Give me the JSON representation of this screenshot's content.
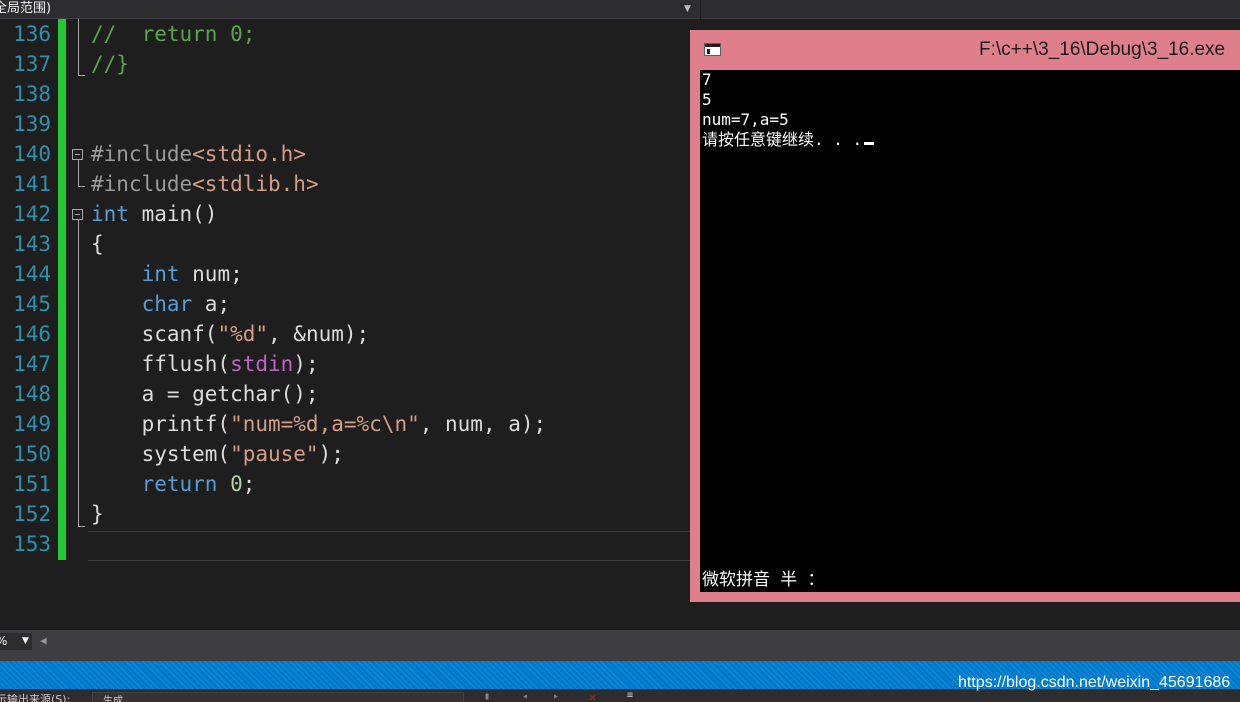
{
  "scope_bar": {
    "label": "全局范围)"
  },
  "editor": {
    "lines": [
      {
        "n": "136",
        "tokens": [
          [
            "cm",
            "//  return 0;"
          ]
        ]
      },
      {
        "n": "137",
        "tokens": [
          [
            "cm",
            "//}"
          ]
        ]
      },
      {
        "n": "138",
        "tokens": []
      },
      {
        "n": "139",
        "tokens": []
      },
      {
        "n": "140",
        "tokens": [
          [
            "pp",
            "#include"
          ],
          [
            "str",
            "<stdio.h>"
          ]
        ]
      },
      {
        "n": "141",
        "tokens": [
          [
            "pp",
            "#include"
          ],
          [
            "str",
            "<stdlib.h>"
          ]
        ]
      },
      {
        "n": "142",
        "tokens": [
          [
            "kw",
            "int"
          ],
          [
            "tx",
            " main()"
          ]
        ]
      },
      {
        "n": "143",
        "tokens": [
          [
            "tx",
            "{"
          ]
        ]
      },
      {
        "n": "144",
        "tokens": [
          [
            "tx",
            "    "
          ],
          [
            "kw",
            "int"
          ],
          [
            "tx",
            " num;"
          ]
        ]
      },
      {
        "n": "145",
        "tokens": [
          [
            "tx",
            "    "
          ],
          [
            "kw",
            "char"
          ],
          [
            "tx",
            " a;"
          ]
        ]
      },
      {
        "n": "146",
        "tokens": [
          [
            "tx",
            "    scanf("
          ],
          [
            "str",
            "\"%d\""
          ],
          [
            "tx",
            ", &num);"
          ]
        ]
      },
      {
        "n": "147",
        "tokens": [
          [
            "tx",
            "    fflush("
          ],
          [
            "mac",
            "stdin"
          ],
          [
            "tx",
            ");"
          ]
        ]
      },
      {
        "n": "148",
        "tokens": [
          [
            "tx",
            "    a = getchar();"
          ]
        ]
      },
      {
        "n": "149",
        "tokens": [
          [
            "tx",
            "    printf("
          ],
          [
            "str",
            "\"num=%d,a=%c\\n\""
          ],
          [
            "tx",
            ", num, a);"
          ]
        ]
      },
      {
        "n": "150",
        "tokens": [
          [
            "tx",
            "    system("
          ],
          [
            "str",
            "\"pause\""
          ],
          [
            "tx",
            ");"
          ]
        ]
      },
      {
        "n": "151",
        "tokens": [
          [
            "tx",
            "    "
          ],
          [
            "kw",
            "return"
          ],
          [
            "tx",
            " "
          ],
          [
            "num",
            "0"
          ],
          [
            "tx",
            ";"
          ]
        ]
      },
      {
        "n": "152",
        "tokens": [
          [
            "tx",
            "}"
          ]
        ]
      },
      {
        "n": "153",
        "tokens": []
      }
    ]
  },
  "zoom": {
    "value": "%"
  },
  "console": {
    "title": "F:\\c++\\3_16\\Debug\\3_16.exe",
    "output": [
      "7",
      "5",
      "num=7,a=5",
      "请按任意键继续. . ."
    ],
    "ime_status": "微软拼音 半 ："
  },
  "bottom_panel": {
    "label": "示输出来源(S):",
    "combo_value": "生成"
  },
  "watermark": "https://blog.csdn.net/weixin_45691686",
  "colors": {
    "keyword": "#569cd6",
    "comment": "#57a64a",
    "string": "#d69d85",
    "line_number": "#2b91af",
    "change_bar": "#21c935",
    "status_bar": "#007acc",
    "console_border": "#df7f8b"
  }
}
